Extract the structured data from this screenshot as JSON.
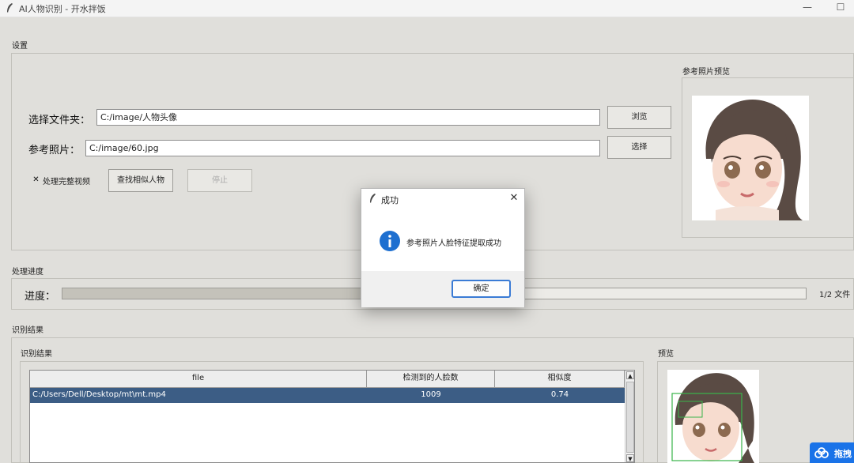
{
  "window": {
    "title": "AI人物识别 - 开水拌饭",
    "minimize_icon": "minimize-icon",
    "maximize_icon": "maximize-icon"
  },
  "settings": {
    "group_label": "设置",
    "folder_label": "选择文件夹：",
    "folder_value": "C:/image/人物头像",
    "browse_label": "浏览",
    "ref_label": "参考照片：",
    "ref_value": "C:/image/60.jpg",
    "select_label": "选择",
    "checkbox_label": "处理完整视频",
    "checkbox_checked": true,
    "find_label": "查找相似人物",
    "stop_label": "停止"
  },
  "ref_preview": {
    "label": "参考照片预览"
  },
  "progress": {
    "group_label": "处理进度",
    "label": "进度：",
    "value": 0.5,
    "count_text": "1/2 文件"
  },
  "results": {
    "group_label": "识别结果",
    "inner_label": "识别结果",
    "columns": [
      "file",
      "检测到的人脸数",
      "相似度"
    ],
    "rows": [
      {
        "file": "C:/Users/Dell/Desktop/mt\\mt.mp4",
        "faces": "1009",
        "similarity": "0.74",
        "selected": true
      }
    ]
  },
  "preview": {
    "label": "预览"
  },
  "dialog": {
    "title": "成功",
    "message": "参考照片人脸特征提取成功",
    "ok_label": "确定",
    "icon": "info-icon"
  },
  "corner_badge": {
    "text": "拖拽",
    "icon": "cloud-icon",
    "color": "#1a73e8"
  }
}
